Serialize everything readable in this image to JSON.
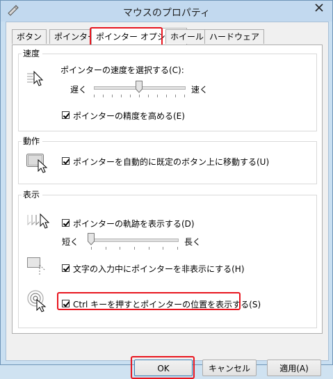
{
  "window": {
    "title": "マウスのプロパティ"
  },
  "tabs": [
    {
      "label": "ボタン"
    },
    {
      "label": "ポインター"
    },
    {
      "label": "ポインター オプション"
    },
    {
      "label": "ホイール"
    },
    {
      "label": "ハードウェア"
    }
  ],
  "motion": {
    "group_label": "速度",
    "speed_label": "ポインターの速度を選択する(C):",
    "slow_label": "遅く",
    "fast_label": "速く",
    "speed_level": 0.5,
    "precision_label": "ポインターの精度を高める(E)",
    "precision_checked": true
  },
  "snap": {
    "group_label": "動作",
    "snap_label": "ポインターを自動的に既定のボタン上に移動する(U)",
    "snap_checked": true
  },
  "visibility": {
    "group_label": "表示",
    "trails_label": "ポインターの軌跡を表示する(D)",
    "trails_checked": true,
    "short_label": "短く",
    "long_label": "長く",
    "trail_level": 0.0,
    "hide_label": "文字の入力中にポインターを非表示にする(H)",
    "hide_checked": true,
    "ctrl_label": "Ctrl キーを押すとポインターの位置を表示する(S)",
    "ctrl_checked": true
  },
  "buttons": {
    "ok": "OK",
    "cancel": "キャンセル",
    "apply": "適用(A)"
  },
  "colors": {
    "highlight": "#e8141e",
    "frame": "#c2d9ef"
  },
  "icons": {
    "app": "mouse-icon",
    "close": "close-icon",
    "speed": "pointer-speed-icon",
    "snap": "snap-to-icon",
    "trails": "pointer-trails-icon",
    "hide": "hide-pointer-icon",
    "ctrl": "pointer-location-icon"
  }
}
